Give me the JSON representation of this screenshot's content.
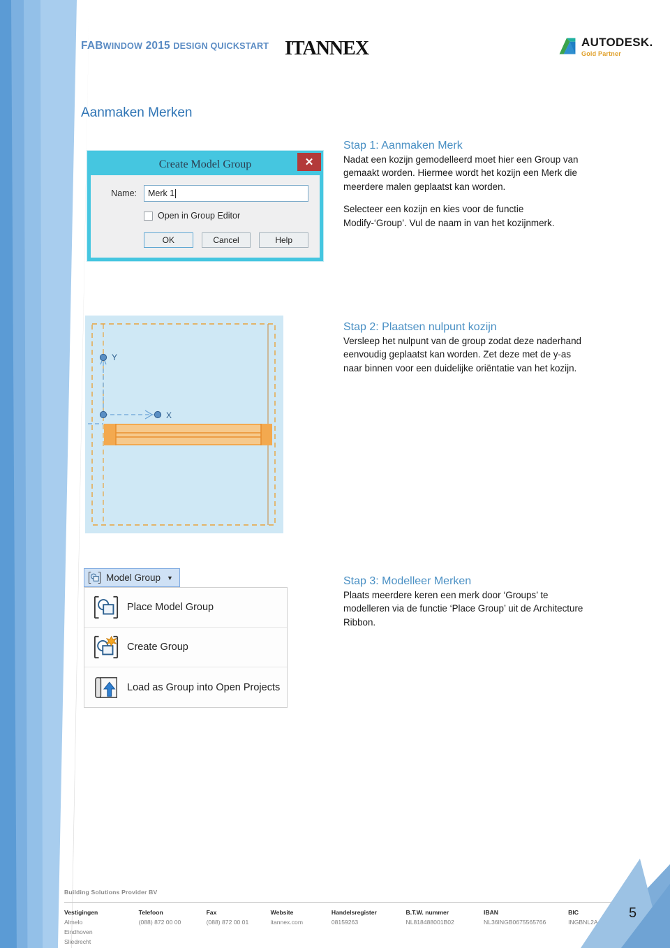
{
  "header": {
    "doc_title_prefix": "FAB",
    "doc_title_small_1": "WINDOW",
    "doc_title_mid": " 2015 ",
    "doc_title_small_2": "DESIGN QUICKSTART",
    "doc_title_full": "FABWINDOW 2015 DESIGN QUICKSTART",
    "brand_logo": "ITANNEX",
    "partner_logo_name": "AUTODESK.",
    "partner_logo_sub": "Gold Partner",
    "partner_mark_icon": "autodesk-a-icon"
  },
  "page_heading": "Aanmaken Merken",
  "dialog": {
    "title": "Create Model Group",
    "close_icon": "close-x-icon",
    "name_label": "Name:",
    "name_value": "Merk 1",
    "name_placeholder": "",
    "checkbox_label": "Open in Group Editor",
    "checkbox_checked": false,
    "buttons": [
      "OK",
      "Cancel",
      "Help"
    ]
  },
  "cad_view": {
    "axis_label_y": "Y",
    "axis_label_x": "X",
    "background_color": "#cfe8f5",
    "selection_color": "#e8a33d",
    "frame_color": "#f0a14b",
    "axis_color": "#4a7fb5"
  },
  "ribbon": {
    "button_label": "Model  Group",
    "button_icon": "model-group-icon",
    "caret_icon": "chevron-down-icon",
    "items": [
      {
        "label": "Place Model Group",
        "icon": "place-model-group-icon"
      },
      {
        "label": "Create Group",
        "icon": "create-group-icon"
      },
      {
        "label": "Load as Group into Open Projects",
        "icon": "load-group-icon"
      }
    ]
  },
  "steps": [
    {
      "title": "Stap 1: Aanmaken Merk",
      "paragraphs": [
        "Nadat een kozijn gemodelleerd moet hier een Group van gemaakt worden. Hiermee wordt het kozijn een Merk die meerdere malen geplaatst kan worden.",
        "Selecteer een kozijn en kies voor de functie Modify-‘Group’. Vul de naam in van het kozijnmerk."
      ]
    },
    {
      "title": "Stap 2: Plaatsen nulpunt kozijn",
      "paragraphs": [
        "Versleep het nulpunt van de group zodat deze naderhand eenvoudig geplaatst kan worden. Zet deze met de y-as naar binnen voor een duidelijke oriëntatie van het kozijn."
      ]
    },
    {
      "title": "Stap 3: Modelleer Merken",
      "paragraphs": [
        "Plaats meerdere keren een merk door ‘Groups’ te modelleren via de functie ‘Place Group’ uit de Architecture Ribbon."
      ]
    }
  ],
  "footer": {
    "company": "Building Solutions Provider BV",
    "columns": [
      {
        "head": "Vestigingen",
        "values": [
          "Almelo",
          "Eindhoven",
          "Sliedrecht"
        ]
      },
      {
        "head": "Telefoon",
        "values": [
          "(088) 872 00 00"
        ]
      },
      {
        "head": "Fax",
        "values": [
          "(088) 872 00 01"
        ]
      },
      {
        "head": "Website",
        "values": [
          "itannex.com"
        ]
      },
      {
        "head": "Handelsregister",
        "values": [
          "08159263"
        ]
      },
      {
        "head": "B.T.W. nummer",
        "values": [
          "NL818488001B02"
        ]
      },
      {
        "head": "IBAN",
        "values": [
          "NL36INGB0675565766"
        ]
      },
      {
        "head": "BIC",
        "values": [
          "INGBNL2A"
        ]
      }
    ]
  },
  "page_number": "5",
  "colors": {
    "accent_blue": "#2e74b5",
    "step_title_blue": "#4a90c4",
    "header_blue": "#5b8cc4",
    "gold": "#e0a02a",
    "dialog_cyan": "#45c6e0",
    "dialog_close_red": "#b33a3a"
  }
}
